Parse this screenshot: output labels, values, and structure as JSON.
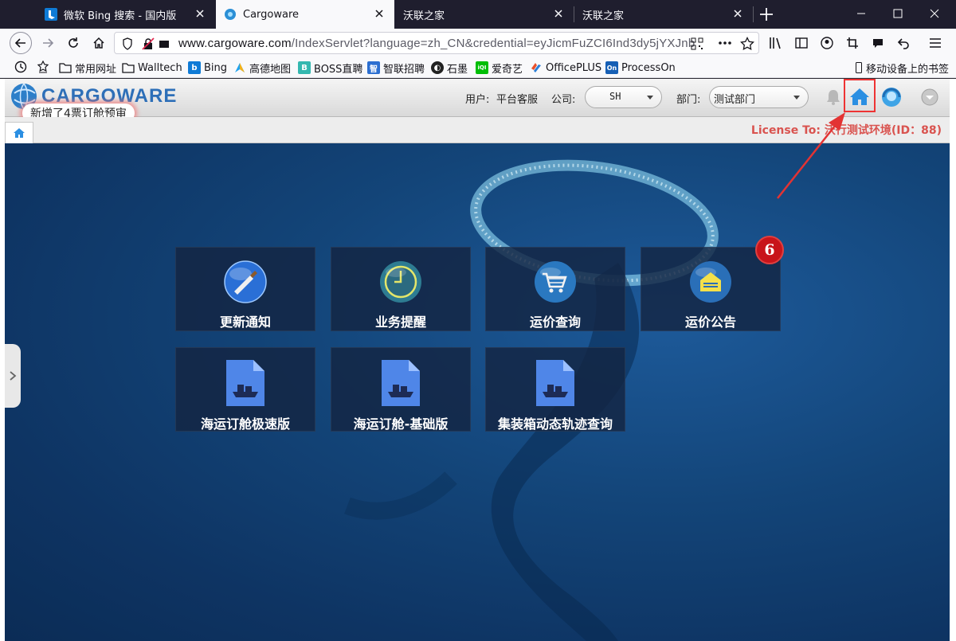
{
  "browser": {
    "tabs": [
      {
        "title": "微软 Bing 搜索 - 国内版",
        "icon": "bing-icon"
      },
      {
        "title": "Cargoware",
        "icon": "cargoware-icon"
      },
      {
        "title": "沃联之家",
        "icon": "none"
      },
      {
        "title": "沃联之家",
        "icon": "none"
      }
    ],
    "active_tab": 1,
    "url_host": "www.cargoware.com",
    "url_rest": "/IndexServlet?language=zh_CN&credential=eyJicmFuZCI6Ind3dy5jYXJnb",
    "bookmarks": [
      {
        "label": "常用网址",
        "icon": "folder-icon"
      },
      {
        "label": "Walltech",
        "icon": "folder-icon"
      },
      {
        "label": "Bing",
        "icon": "bing-icon"
      },
      {
        "label": "高德地图",
        "icon": "amap-icon"
      },
      {
        "label": "BOSS直聘",
        "icon": "boss-icon"
      },
      {
        "label": "智联招聘",
        "icon": "zhaopin-icon"
      },
      {
        "label": "石墨",
        "icon": "shimo-icon"
      },
      {
        "label": "爱奇艺",
        "icon": "iqiyi-icon"
      },
      {
        "label": "OfficePLUS",
        "icon": "officeplus-icon"
      },
      {
        "label": "ProcessOn",
        "icon": "processon-icon"
      }
    ],
    "mobile_bookmarks": "移动设备上的书签"
  },
  "app": {
    "brand": "CARGOWARE",
    "notification": "新增了4票订舱预审",
    "user_label": "用户:",
    "user_value": "平台客服",
    "company_label": "公司:",
    "company_value": "SH",
    "dept_label": "部门:",
    "dept_value": "测试部门",
    "license": "License To: 沃行测试环境(ID：88)",
    "badge_count": "6",
    "tiles": [
      {
        "label": "更新通知",
        "icon": "brush-icon"
      },
      {
        "label": "业务提醒",
        "icon": "clock-icon"
      },
      {
        "label": "运价查询",
        "icon": "cart-icon"
      },
      {
        "label": "运价公告",
        "icon": "notice-icon"
      },
      {
        "label": "海运订舱极速版",
        "icon": "ship-doc-icon"
      },
      {
        "label": "海运订舱-基础版",
        "icon": "ship-doc-icon"
      },
      {
        "label": "集装箱动态轨迹查询",
        "icon": "ship-doc-icon"
      }
    ]
  },
  "colors": {
    "accent": "#d9534f",
    "highlight": "#e33333",
    "page_bg": "#113a6b"
  }
}
